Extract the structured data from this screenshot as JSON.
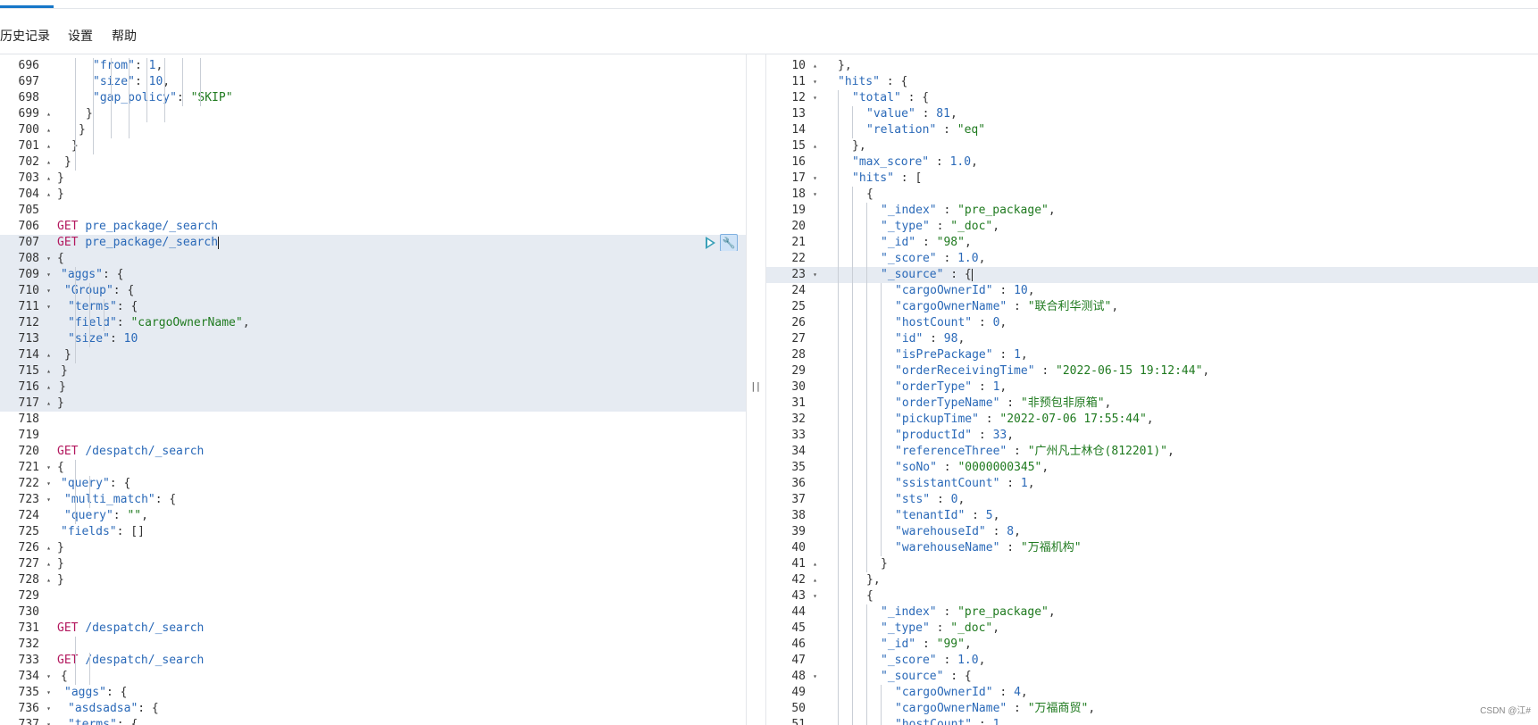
{
  "menu": {
    "items": [
      "历史记录",
      "设置",
      "帮助"
    ]
  },
  "colors": {
    "key": "#2a69b8",
    "string": "#1f7a1f",
    "method": "#b3185e",
    "highlight": "#e6ebf2",
    "accent": "#1677c8"
  },
  "icons": {
    "run": "play-triangle-icon",
    "wrench": "wrench-icon"
  },
  "left_editor": {
    "lines": [
      {
        "n": "696",
        "f": "",
        "t": [
          [
            "k",
            "\"from\""
          ],
          [
            "p",
            ": "
          ],
          [
            "n",
            "1"
          ],
          [
            "p",
            ","
          ]
        ]
      },
      {
        "n": "697",
        "f": "",
        "t": [
          [
            "k",
            "\"size\""
          ],
          [
            "p",
            ": "
          ],
          [
            "n",
            "10"
          ],
          [
            "p",
            ","
          ]
        ]
      },
      {
        "n": "698",
        "f": "",
        "t": [
          [
            "k",
            "\"gap_policy\""
          ],
          [
            "p",
            ": "
          ],
          [
            "s",
            "\"SKIP\""
          ]
        ]
      },
      {
        "n": "699",
        "f": "▴",
        "t": [
          [
            "p",
            "}"
          ]
        ]
      },
      {
        "n": "700",
        "f": "▴",
        "t": [
          [
            "p",
            "}"
          ]
        ]
      },
      {
        "n": "701",
        "f": "▴",
        "t": [
          [
            "p",
            "}"
          ]
        ]
      },
      {
        "n": "702",
        "f": "▴",
        "t": [
          [
            "p",
            "}"
          ]
        ]
      },
      {
        "n": "703",
        "f": "▴",
        "t": [
          [
            "p",
            "}"
          ]
        ]
      },
      {
        "n": "704",
        "f": "▴",
        "t": [
          [
            "p",
            "}"
          ]
        ]
      },
      {
        "n": "705",
        "f": "",
        "t": []
      },
      {
        "n": "706",
        "f": "",
        "t": [
          [
            "m",
            "GET"
          ],
          [
            "p",
            " "
          ],
          [
            "k",
            "pre_package/_search"
          ]
        ]
      },
      {
        "n": "707",
        "f": "",
        "t": [
          [
            "m",
            "GET"
          ],
          [
            "p",
            " "
          ],
          [
            "k",
            "pre_package/_search"
          ]
        ]
      },
      {
        "n": "708",
        "f": "▾",
        "t": [
          [
            "p",
            "{"
          ]
        ]
      },
      {
        "n": "709",
        "f": "▾",
        "t": [
          [
            "k",
            "\"aggs\""
          ],
          [
            "p",
            ": {"
          ]
        ]
      },
      {
        "n": "710",
        "f": "▾",
        "t": [
          [
            "k",
            "\"Group\""
          ],
          [
            "p",
            ": {"
          ]
        ]
      },
      {
        "n": "711",
        "f": "▾",
        "t": [
          [
            "k",
            "\"terms\""
          ],
          [
            "p",
            ": {"
          ]
        ]
      },
      {
        "n": "712",
        "f": "",
        "t": [
          [
            "k",
            "\"field\""
          ],
          [
            "p",
            ": "
          ],
          [
            "s",
            "\"cargoOwnerName\""
          ],
          [
            "p",
            ","
          ]
        ]
      },
      {
        "n": "713",
        "f": "",
        "t": [
          [
            "k",
            "\"size\""
          ],
          [
            "p",
            ": "
          ],
          [
            "n",
            "10"
          ]
        ]
      },
      {
        "n": "714",
        "f": "▴",
        "t": [
          [
            "p",
            "}"
          ]
        ]
      },
      {
        "n": "715",
        "f": "▴",
        "t": [
          [
            "p",
            "}"
          ]
        ]
      },
      {
        "n": "716",
        "f": "▴",
        "t": [
          [
            "p",
            "}"
          ]
        ]
      },
      {
        "n": "717",
        "f": "▴",
        "t": [
          [
            "p",
            "}"
          ]
        ]
      },
      {
        "n": "718",
        "f": "",
        "t": []
      },
      {
        "n": "719",
        "f": "",
        "t": []
      },
      {
        "n": "720",
        "f": "",
        "t": [
          [
            "m",
            "GET"
          ],
          [
            "p",
            " "
          ],
          [
            "k",
            "/despatch/_search"
          ]
        ]
      },
      {
        "n": "721",
        "f": "▾",
        "t": [
          [
            "p",
            "{"
          ]
        ]
      },
      {
        "n": "722",
        "f": "▾",
        "t": [
          [
            "k",
            "\"query\""
          ],
          [
            "p",
            ": {"
          ]
        ]
      },
      {
        "n": "723",
        "f": "▾",
        "t": [
          [
            "k",
            "\"multi_match\""
          ],
          [
            "p",
            ": {"
          ]
        ]
      },
      {
        "n": "724",
        "f": "",
        "t": [
          [
            "k",
            "\"query\""
          ],
          [
            "p",
            ": "
          ],
          [
            "s",
            "\"\""
          ],
          [
            "p",
            ","
          ]
        ]
      },
      {
        "n": "725",
        "f": "",
        "t": [
          [
            "k",
            "\"fields\""
          ],
          [
            "p",
            ": []"
          ]
        ]
      },
      {
        "n": "726",
        "f": "▴",
        "t": [
          [
            "p",
            "}"
          ]
        ]
      },
      {
        "n": "727",
        "f": "▴",
        "t": [
          [
            "p",
            "}"
          ]
        ]
      },
      {
        "n": "728",
        "f": "▴",
        "t": [
          [
            "p",
            "}"
          ]
        ]
      },
      {
        "n": "729",
        "f": "",
        "t": []
      },
      {
        "n": "730",
        "f": "",
        "t": []
      },
      {
        "n": "731",
        "f": "",
        "t": [
          [
            "m",
            "GET"
          ],
          [
            "p",
            " "
          ],
          [
            "k",
            "/despatch/_search"
          ]
        ]
      },
      {
        "n": "732",
        "f": "",
        "t": []
      },
      {
        "n": "733",
        "f": "",
        "t": [
          [
            "m",
            "GET"
          ],
          [
            "p",
            " "
          ],
          [
            "k",
            "/despatch/_search"
          ]
        ]
      },
      {
        "n": "734",
        "f": "▾",
        "t": [
          [
            "p",
            "{"
          ]
        ]
      },
      {
        "n": "735",
        "f": "▾",
        "t": [
          [
            "k",
            "\"aggs\""
          ],
          [
            "p",
            ": {"
          ]
        ]
      },
      {
        "n": "736",
        "f": "▾",
        "t": [
          [
            "k",
            "\"asdsadsa\""
          ],
          [
            "p",
            ": {"
          ]
        ]
      },
      {
        "n": "737",
        "f": "▾",
        "t": [
          [
            "k",
            "\"terms\""
          ],
          [
            "p",
            ": {"
          ]
        ]
      }
    ]
  },
  "right_editor": {
    "lines": [
      {
        "n": "10",
        "f": "▴",
        "t": [
          [
            "p",
            "},"
          ]
        ]
      },
      {
        "n": "11",
        "f": "▾",
        "t": [
          [
            "k",
            "\"hits\""
          ],
          [
            "p",
            " : {"
          ]
        ]
      },
      {
        "n": "12",
        "f": "▾",
        "t": [
          [
            "k",
            "\"total\""
          ],
          [
            "p",
            " : {"
          ]
        ]
      },
      {
        "n": "13",
        "f": "",
        "t": [
          [
            "k",
            "\"value\""
          ],
          [
            "p",
            " : "
          ],
          [
            "n",
            "81"
          ],
          [
            "p",
            ","
          ]
        ]
      },
      {
        "n": "14",
        "f": "",
        "t": [
          [
            "k",
            "\"relation\""
          ],
          [
            "p",
            " : "
          ],
          [
            "s",
            "\"eq\""
          ]
        ]
      },
      {
        "n": "15",
        "f": "▴",
        "t": [
          [
            "p",
            "},"
          ]
        ]
      },
      {
        "n": "16",
        "f": "",
        "t": [
          [
            "k",
            "\"max_score\""
          ],
          [
            "p",
            " : "
          ],
          [
            "n",
            "1.0"
          ],
          [
            "p",
            ","
          ]
        ]
      },
      {
        "n": "17",
        "f": "▾",
        "t": [
          [
            "k",
            "\"hits\""
          ],
          [
            "p",
            " : ["
          ]
        ]
      },
      {
        "n": "18",
        "f": "▾",
        "t": [
          [
            "p",
            "{"
          ]
        ]
      },
      {
        "n": "19",
        "f": "",
        "t": [
          [
            "k",
            "\"_index\""
          ],
          [
            "p",
            " : "
          ],
          [
            "s",
            "\"pre_package\""
          ],
          [
            "p",
            ","
          ]
        ]
      },
      {
        "n": "20",
        "f": "",
        "t": [
          [
            "k",
            "\"_type\""
          ],
          [
            "p",
            " : "
          ],
          [
            "s",
            "\"_doc\""
          ],
          [
            "p",
            ","
          ]
        ]
      },
      {
        "n": "21",
        "f": "",
        "t": [
          [
            "k",
            "\"_id\""
          ],
          [
            "p",
            " : "
          ],
          [
            "s",
            "\"98\""
          ],
          [
            "p",
            ","
          ]
        ]
      },
      {
        "n": "22",
        "f": "",
        "t": [
          [
            "k",
            "\"_score\""
          ],
          [
            "p",
            " : "
          ],
          [
            "n",
            "1.0"
          ],
          [
            "p",
            ","
          ]
        ]
      },
      {
        "n": "23",
        "f": "▾",
        "t": [
          [
            "k",
            "\"_source\""
          ],
          [
            "p",
            " : {"
          ]
        ]
      },
      {
        "n": "24",
        "f": "",
        "t": [
          [
            "k",
            "\"cargoOwnerId\""
          ],
          [
            "p",
            " : "
          ],
          [
            "n",
            "10"
          ],
          [
            "p",
            ","
          ]
        ]
      },
      {
        "n": "25",
        "f": "",
        "t": [
          [
            "k",
            "\"cargoOwnerName\""
          ],
          [
            "p",
            " : "
          ],
          [
            "s",
            "\"联合利华测试\""
          ],
          [
            "p",
            ","
          ]
        ]
      },
      {
        "n": "26",
        "f": "",
        "t": [
          [
            "k",
            "\"hostCount\""
          ],
          [
            "p",
            " : "
          ],
          [
            "n",
            "0"
          ],
          [
            "p",
            ","
          ]
        ]
      },
      {
        "n": "27",
        "f": "",
        "t": [
          [
            "k",
            "\"id\""
          ],
          [
            "p",
            " : "
          ],
          [
            "n",
            "98"
          ],
          [
            "p",
            ","
          ]
        ]
      },
      {
        "n": "28",
        "f": "",
        "t": [
          [
            "k",
            "\"isPrePackage\""
          ],
          [
            "p",
            " : "
          ],
          [
            "n",
            "1"
          ],
          [
            "p",
            ","
          ]
        ]
      },
      {
        "n": "29",
        "f": "",
        "t": [
          [
            "k",
            "\"orderReceivingTime\""
          ],
          [
            "p",
            " : "
          ],
          [
            "s",
            "\"2022-06-15 19:12:44\""
          ],
          [
            "p",
            ","
          ]
        ]
      },
      {
        "n": "30",
        "f": "",
        "t": [
          [
            "k",
            "\"orderType\""
          ],
          [
            "p",
            " : "
          ],
          [
            "n",
            "1"
          ],
          [
            "p",
            ","
          ]
        ]
      },
      {
        "n": "31",
        "f": "",
        "t": [
          [
            "k",
            "\"orderTypeName\""
          ],
          [
            "p",
            " : "
          ],
          [
            "s",
            "\"非预包非原箱\""
          ],
          [
            "p",
            ","
          ]
        ]
      },
      {
        "n": "32",
        "f": "",
        "t": [
          [
            "k",
            "\"pickupTime\""
          ],
          [
            "p",
            " : "
          ],
          [
            "s",
            "\"2022-07-06 17:55:44\""
          ],
          [
            "p",
            ","
          ]
        ]
      },
      {
        "n": "33",
        "f": "",
        "t": [
          [
            "k",
            "\"productId\""
          ],
          [
            "p",
            " : "
          ],
          [
            "n",
            "33"
          ],
          [
            "p",
            ","
          ]
        ]
      },
      {
        "n": "34",
        "f": "",
        "t": [
          [
            "k",
            "\"referenceThree\""
          ],
          [
            "p",
            " : "
          ],
          [
            "s",
            "\"广州凡士林仓(812201)\""
          ],
          [
            "p",
            ","
          ]
        ]
      },
      {
        "n": "35",
        "f": "",
        "t": [
          [
            "k",
            "\"soNo\""
          ],
          [
            "p",
            " : "
          ],
          [
            "s",
            "\"0000000345\""
          ],
          [
            "p",
            ","
          ]
        ]
      },
      {
        "n": "36",
        "f": "",
        "t": [
          [
            "k",
            "\"ssistantCount\""
          ],
          [
            "p",
            " : "
          ],
          [
            "n",
            "1"
          ],
          [
            "p",
            ","
          ]
        ]
      },
      {
        "n": "37",
        "f": "",
        "t": [
          [
            "k",
            "\"sts\""
          ],
          [
            "p",
            " : "
          ],
          [
            "n",
            "0"
          ],
          [
            "p",
            ","
          ]
        ]
      },
      {
        "n": "38",
        "f": "",
        "t": [
          [
            "k",
            "\"tenantId\""
          ],
          [
            "p",
            " : "
          ],
          [
            "n",
            "5"
          ],
          [
            "p",
            ","
          ]
        ]
      },
      {
        "n": "39",
        "f": "",
        "t": [
          [
            "k",
            "\"warehouseId\""
          ],
          [
            "p",
            " : "
          ],
          [
            "n",
            "8"
          ],
          [
            "p",
            ","
          ]
        ]
      },
      {
        "n": "40",
        "f": "",
        "t": [
          [
            "k",
            "\"warehouseName\""
          ],
          [
            "p",
            " : "
          ],
          [
            "s",
            "\"万福机构\""
          ]
        ]
      },
      {
        "n": "41",
        "f": "▴",
        "t": [
          [
            "p",
            "}"
          ]
        ]
      },
      {
        "n": "42",
        "f": "▴",
        "t": [
          [
            "p",
            "},"
          ]
        ]
      },
      {
        "n": "43",
        "f": "▾",
        "t": [
          [
            "p",
            "{"
          ]
        ]
      },
      {
        "n": "44",
        "f": "",
        "t": [
          [
            "k",
            "\"_index\""
          ],
          [
            "p",
            " : "
          ],
          [
            "s",
            "\"pre_package\""
          ],
          [
            "p",
            ","
          ]
        ]
      },
      {
        "n": "45",
        "f": "",
        "t": [
          [
            "k",
            "\"_type\""
          ],
          [
            "p",
            " : "
          ],
          [
            "s",
            "\"_doc\""
          ],
          [
            "p",
            ","
          ]
        ]
      },
      {
        "n": "46",
        "f": "",
        "t": [
          [
            "k",
            "\"_id\""
          ],
          [
            "p",
            " : "
          ],
          [
            "s",
            "\"99\""
          ],
          [
            "p",
            ","
          ]
        ]
      },
      {
        "n": "47",
        "f": "",
        "t": [
          [
            "k",
            "\"_score\""
          ],
          [
            "p",
            " : "
          ],
          [
            "n",
            "1.0"
          ],
          [
            "p",
            ","
          ]
        ]
      },
      {
        "n": "48",
        "f": "▾",
        "t": [
          [
            "k",
            "\"_source\""
          ],
          [
            "p",
            " : {"
          ]
        ]
      },
      {
        "n": "49",
        "f": "",
        "t": [
          [
            "k",
            "\"cargoOwnerId\""
          ],
          [
            "p",
            " : "
          ],
          [
            "n",
            "4"
          ],
          [
            "p",
            ","
          ]
        ]
      },
      {
        "n": "50",
        "f": "",
        "t": [
          [
            "k",
            "\"cargoOwnerName\""
          ],
          [
            "p",
            " : "
          ],
          [
            "s",
            "\"万福商贸\""
          ],
          [
            "p",
            ","
          ]
        ]
      },
      {
        "n": "51",
        "f": "",
        "t": [
          [
            "k",
            "\"hostCount\""
          ],
          [
            "p",
            " : "
          ],
          [
            "n",
            "1"
          ]
        ]
      }
    ]
  },
  "divider_grip": "||",
  "watermark": "CSDN @江#"
}
